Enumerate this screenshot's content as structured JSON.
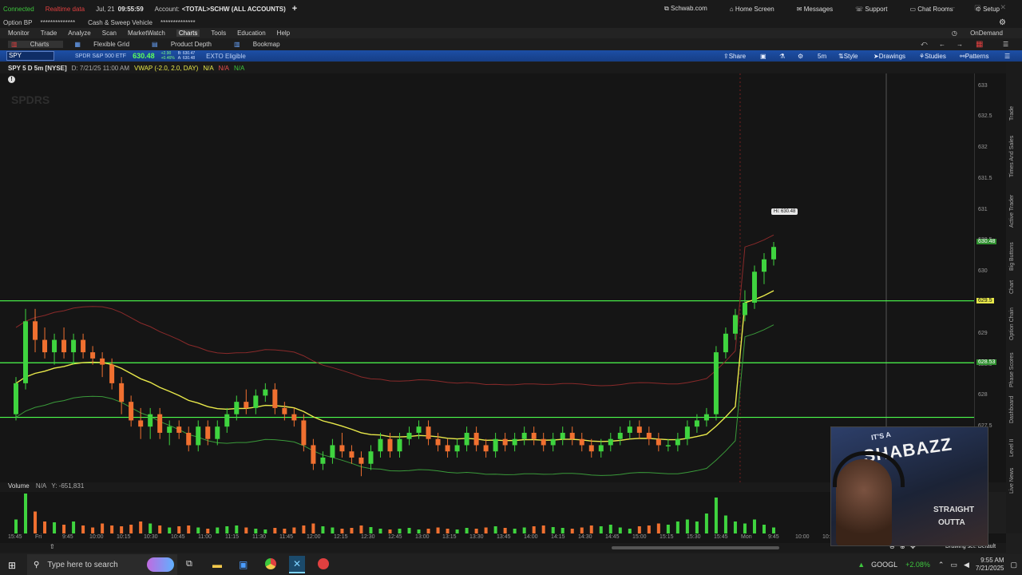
{
  "status": {
    "connected": "Connected",
    "realtime": "Realtime data",
    "date": "Jul, 21",
    "time": "09:55:59",
    "account_label": "Account:",
    "account": "<TOTAL>SCHW (ALL ACCOUNTS)",
    "links": {
      "schwab": "Schwab.com",
      "home": "Home Screen",
      "messages": "Messages",
      "support": "Support",
      "chat": "Chat Rooms",
      "setup": "Setup"
    }
  },
  "option_row": {
    "option_bp": "Option BP",
    "masked1": "**************",
    "sweep": "Cash & Sweep Vehicle",
    "masked2": "**************"
  },
  "menu": [
    "Monitor",
    "Trade",
    "Analyze",
    "Scan",
    "MarketWatch",
    "Charts",
    "Tools",
    "Education",
    "Help"
  ],
  "menu_active": "Charts",
  "ondemand": "OnDemand",
  "subtabs": [
    "Charts",
    "Flexible Grid",
    "Product Depth",
    "Bookmap"
  ],
  "symbol_bar": {
    "symbol": "SPY",
    "description": "SPDR S&P 500 ETF",
    "price": "630.48",
    "change": "+2.90",
    "change_pct": "+0.46%",
    "bid": "B: 630.47",
    "ask": "A: 630.48",
    "exto": "EXTO Eligible",
    "tools": {
      "share": "Share",
      "timeframe": "5m",
      "style": "Style",
      "drawings": "Drawings",
      "studies": "Studies",
      "patterns": "Patterns"
    }
  },
  "info_bar": {
    "title": "SPY 5 D 5m [NYSE]",
    "date": "D: 7/21/25 11:00 AM",
    "vwap": "VWAP (-2.0, 2.0, DAY)",
    "na1": "N/A",
    "na2": "N/A",
    "na3": "N/A"
  },
  "hi_label": "Hi: 630.48",
  "price_ticks": [
    "633",
    "632.5",
    "632",
    "631.5",
    "631",
    "630.5",
    "630",
    "629.5",
    "629",
    "628.5",
    "628",
    "627.5",
    "627"
  ],
  "price_tags": {
    "last": "630.48",
    "level1": "629.5",
    "level2": "628.53"
  },
  "volume_header": {
    "label": "Volume",
    "na": "N/A",
    "y": "Y: -651,831"
  },
  "time_labels": [
    "15:45",
    "Fri",
    "9:45",
    "10:00",
    "10:15",
    "10:30",
    "10:45",
    "11:00",
    "11:15",
    "11:30",
    "11:45",
    "12:00",
    "12:15",
    "12:30",
    "12:45",
    "13:00",
    "13:15",
    "13:30",
    "13:45",
    "14:00",
    "14:15",
    "14:30",
    "14:45",
    "15:00",
    "15:15",
    "15:30",
    "15:45",
    "Mon",
    "9:45",
    "10:00",
    "10:15"
  ],
  "drawing_set": "Drawing set: Default",
  "sidebar_tabs": [
    "Trade",
    "Times And Sales",
    "Active Trader",
    "Big Buttons",
    "Chart",
    "Option Chain",
    "Phase Scores",
    "Dashboard",
    "Level II",
    "Live News"
  ],
  "webcam_text": [
    "IT'S A",
    "SHABAZZ",
    "STRAIGHT",
    "OUTTA"
  ],
  "taskbar": {
    "search_placeholder": "Type here to search",
    "ticker": "GOOGL",
    "ticker_change": "+2.08%",
    "clock_time": "9:55 AM",
    "clock_date": "7/21/2025"
  },
  "colors": {
    "up": "#3fd43f",
    "down": "#f07030",
    "vwap": "#e8e84a",
    "levels": "#4cff4c",
    "accent": "#1d4fa5"
  },
  "chart_data": {
    "type": "candlestick",
    "symbol": "SPY",
    "interval": "5m",
    "ylim": [
      626.6,
      633.2
    ],
    "session_break_index": 76,
    "horizontal_levels": [
      629.53,
      628.53,
      627.65
    ],
    "candles": [
      [
        627.7,
        628.3,
        627.6,
        628.2
      ],
      [
        628.2,
        629.4,
        628.1,
        629.2
      ],
      [
        629.2,
        629.4,
        628.7,
        628.9
      ],
      [
        628.9,
        629.1,
        628.6,
        628.7
      ],
      [
        628.7,
        629.0,
        628.5,
        628.9
      ],
      [
        628.9,
        629.1,
        628.6,
        628.7
      ],
      [
        628.7,
        629.0,
        628.5,
        628.9
      ],
      [
        628.9,
        629.0,
        628.6,
        628.7
      ],
      [
        628.7,
        628.8,
        628.5,
        628.6
      ],
      [
        628.6,
        628.7,
        628.3,
        628.5
      ],
      [
        628.5,
        628.6,
        628.1,
        628.2
      ],
      [
        628.2,
        628.3,
        627.7,
        627.9
      ],
      [
        627.9,
        628.0,
        627.5,
        627.6
      ],
      [
        627.6,
        627.8,
        627.3,
        627.5
      ],
      [
        627.5,
        627.8,
        627.3,
        627.7
      ],
      [
        627.7,
        627.8,
        627.3,
        627.4
      ],
      [
        627.4,
        627.6,
        627.2,
        627.5
      ],
      [
        627.5,
        627.6,
        627.3,
        627.4
      ],
      [
        627.4,
        627.5,
        627.1,
        627.2
      ],
      [
        627.2,
        627.6,
        627.1,
        627.5
      ],
      [
        627.5,
        627.6,
        627.2,
        627.3
      ],
      [
        627.3,
        627.6,
        627.2,
        627.5
      ],
      [
        627.5,
        627.8,
        627.4,
        627.7
      ],
      [
        627.7,
        628.0,
        627.6,
        627.9
      ],
      [
        627.9,
        628.1,
        627.7,
        627.8
      ],
      [
        627.8,
        628.1,
        627.7,
        628.0
      ],
      [
        628.0,
        628.2,
        627.9,
        628.1
      ],
      [
        628.1,
        628.2,
        627.7,
        627.8
      ],
      [
        627.8,
        627.9,
        627.6,
        627.7
      ],
      [
        627.7,
        627.8,
        627.5,
        627.6
      ],
      [
        627.6,
        627.7,
        627.1,
        627.2
      ],
      [
        627.2,
        627.3,
        626.8,
        626.9
      ],
      [
        626.9,
        627.1,
        626.8,
        627.0
      ],
      [
        627.0,
        627.3,
        626.9,
        627.2
      ],
      [
        627.2,
        627.4,
        627.0,
        627.1
      ],
      [
        627.1,
        627.2,
        626.9,
        627.0
      ],
      [
        627.0,
        627.1,
        626.7,
        626.9
      ],
      [
        626.9,
        627.2,
        626.8,
        627.1
      ],
      [
        627.1,
        627.4,
        627.0,
        627.3
      ],
      [
        627.3,
        627.4,
        627.0,
        627.1
      ],
      [
        627.1,
        627.4,
        627.0,
        627.3
      ],
      [
        627.3,
        627.5,
        627.2,
        627.4
      ],
      [
        627.4,
        627.6,
        627.3,
        627.5
      ],
      [
        627.5,
        627.6,
        627.2,
        627.3
      ],
      [
        627.3,
        627.4,
        627.1,
        627.2
      ],
      [
        627.2,
        627.3,
        627.0,
        627.1
      ],
      [
        627.1,
        627.3,
        627.0,
        627.2
      ],
      [
        627.2,
        627.5,
        627.1,
        627.4
      ],
      [
        627.4,
        627.5,
        627.1,
        627.2
      ],
      [
        627.2,
        627.3,
        627.0,
        627.1
      ],
      [
        627.1,
        627.4,
        627.0,
        627.3
      ],
      [
        627.3,
        627.4,
        627.1,
        627.2
      ],
      [
        627.2,
        627.4,
        627.1,
        627.3
      ],
      [
        627.3,
        627.5,
        627.2,
        627.4
      ],
      [
        627.4,
        627.5,
        627.2,
        627.3
      ],
      [
        627.3,
        627.4,
        627.1,
        627.2
      ],
      [
        627.2,
        627.4,
        627.1,
        627.3
      ],
      [
        627.3,
        627.5,
        627.2,
        627.4
      ],
      [
        627.4,
        627.5,
        627.2,
        627.3
      ],
      [
        627.3,
        627.4,
        627.1,
        627.2
      ],
      [
        627.2,
        627.3,
        627.0,
        627.1
      ],
      [
        627.1,
        627.3,
        627.0,
        627.2
      ],
      [
        627.2,
        627.4,
        627.1,
        627.3
      ],
      [
        627.3,
        627.5,
        627.2,
        627.4
      ],
      [
        627.4,
        627.6,
        627.3,
        627.5
      ],
      [
        627.5,
        627.6,
        627.3,
        627.4
      ],
      [
        627.4,
        627.5,
        627.2,
        627.3
      ],
      [
        627.3,
        627.4,
        627.1,
        627.2
      ],
      [
        627.2,
        627.3,
        627.1,
        627.2
      ],
      [
        627.2,
        627.4,
        627.1,
        627.3
      ],
      [
        627.3,
        627.6,
        627.2,
        627.5
      ],
      [
        627.5,
        627.7,
        627.4,
        627.6
      ],
      [
        627.6,
        627.8,
        627.5,
        627.7
      ],
      [
        627.7,
        628.8,
        627.6,
        628.7
      ],
      [
        628.7,
        629.1,
        628.6,
        629.0
      ],
      [
        629.0,
        629.4,
        628.9,
        629.3
      ],
      [
        629.3,
        629.7,
        629.2,
        629.5
      ],
      [
        629.5,
        630.1,
        629.4,
        630.0
      ],
      [
        630.0,
        630.3,
        629.8,
        630.2
      ],
      [
        630.2,
        630.48,
        630.1,
        630.4
      ]
    ],
    "volume": [
      0.35,
      1.0,
      0.55,
      0.3,
      0.28,
      0.22,
      0.3,
      0.2,
      0.15,
      0.25,
      0.2,
      0.18,
      0.22,
      0.3,
      0.25,
      0.2,
      0.15,
      0.18,
      0.2,
      0.15,
      0.12,
      0.15,
      0.18,
      0.2,
      0.15,
      0.12,
      0.1,
      0.14,
      0.12,
      0.15,
      0.2,
      0.25,
      0.18,
      0.15,
      0.12,
      0.14,
      0.2,
      0.16,
      0.12,
      0.1,
      0.12,
      0.14,
      0.1,
      0.12,
      0.15,
      0.12,
      0.1,
      0.14,
      0.12,
      0.15,
      0.18,
      0.14,
      0.12,
      0.15,
      0.18,
      0.2,
      0.16,
      0.14,
      0.12,
      0.15,
      0.2,
      0.18,
      0.22,
      0.15,
      0.12,
      0.18,
      0.2,
      0.25,
      0.22,
      0.3,
      0.35,
      0.3,
      0.5,
      0.9,
      0.45,
      0.3,
      0.25,
      0.35,
      0.22,
      0.15
    ]
  }
}
